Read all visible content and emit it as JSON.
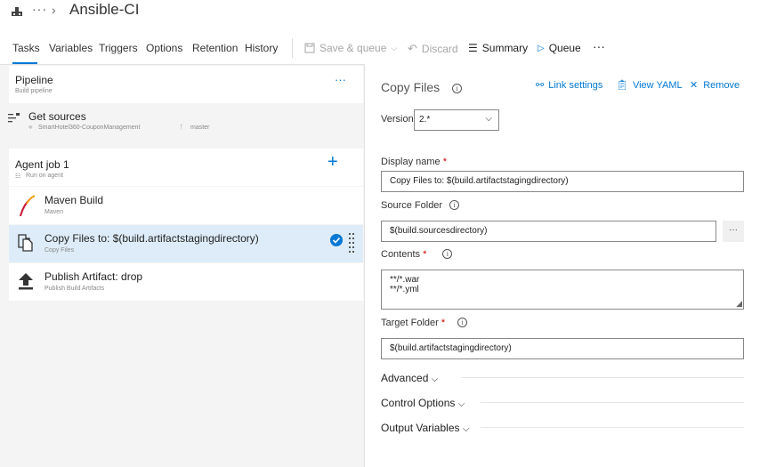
{
  "header": {
    "title": "Ansible-CI",
    "ellipsis": "···",
    "chevron": "›"
  },
  "tabs": [
    {
      "label": "Tasks"
    },
    {
      "label": "Variables"
    },
    {
      "label": "Triggers"
    },
    {
      "label": "Options"
    },
    {
      "label": "Retention"
    },
    {
      "label": "History"
    }
  ],
  "toolbar": {
    "save_queue": "Save & queue",
    "discard": "Discard",
    "summary": "Summary",
    "queue": "Queue",
    "more": "···"
  },
  "pipeline": {
    "title": "Pipeline",
    "subtitle": "Build pipeline",
    "more": "···"
  },
  "get_sources": {
    "title": "Get sources",
    "repo": "SmartHotel360-CouponManagement",
    "branch": "master"
  },
  "agent_job": {
    "title": "Agent job 1",
    "subtitle": "Run on agent",
    "add": "+"
  },
  "tasks": [
    {
      "title": "Maven Build",
      "subtitle": "Maven"
    },
    {
      "title": "Copy Files to: $(build.artifactstagingdirectory)",
      "subtitle": "Copy Files"
    },
    {
      "title": "Publish Artifact: drop",
      "subtitle": "Publish Build Artifacts"
    }
  ],
  "details": {
    "title": "Copy Files",
    "link_settings": "Link settings",
    "view_yaml": "View YAML",
    "remove": "Remove",
    "version_label": "Version",
    "version_value": "2.*",
    "display_name_label": "Display name",
    "display_name_value": "Copy Files to: $(build.artifactstagingdirectory)",
    "source_folder_label": "Source Folder",
    "source_folder_value": "$(build.sourcesdirectory)",
    "browse": "···",
    "contents_label": "Contents",
    "contents_line1": "**/*.war",
    "contents_line2": "**/*.yml",
    "target_folder_label": "Target Folder",
    "target_folder_value": "$(build.artifactstagingdirectory)",
    "required_mark": "*",
    "info_glyph": "i",
    "advanced": "Advanced",
    "control_options": "Control Options",
    "output_variables": "Output Variables"
  },
  "colors": {
    "accent": "#0078d4",
    "selected_row": "#deecf9",
    "required": "#cc0000"
  }
}
